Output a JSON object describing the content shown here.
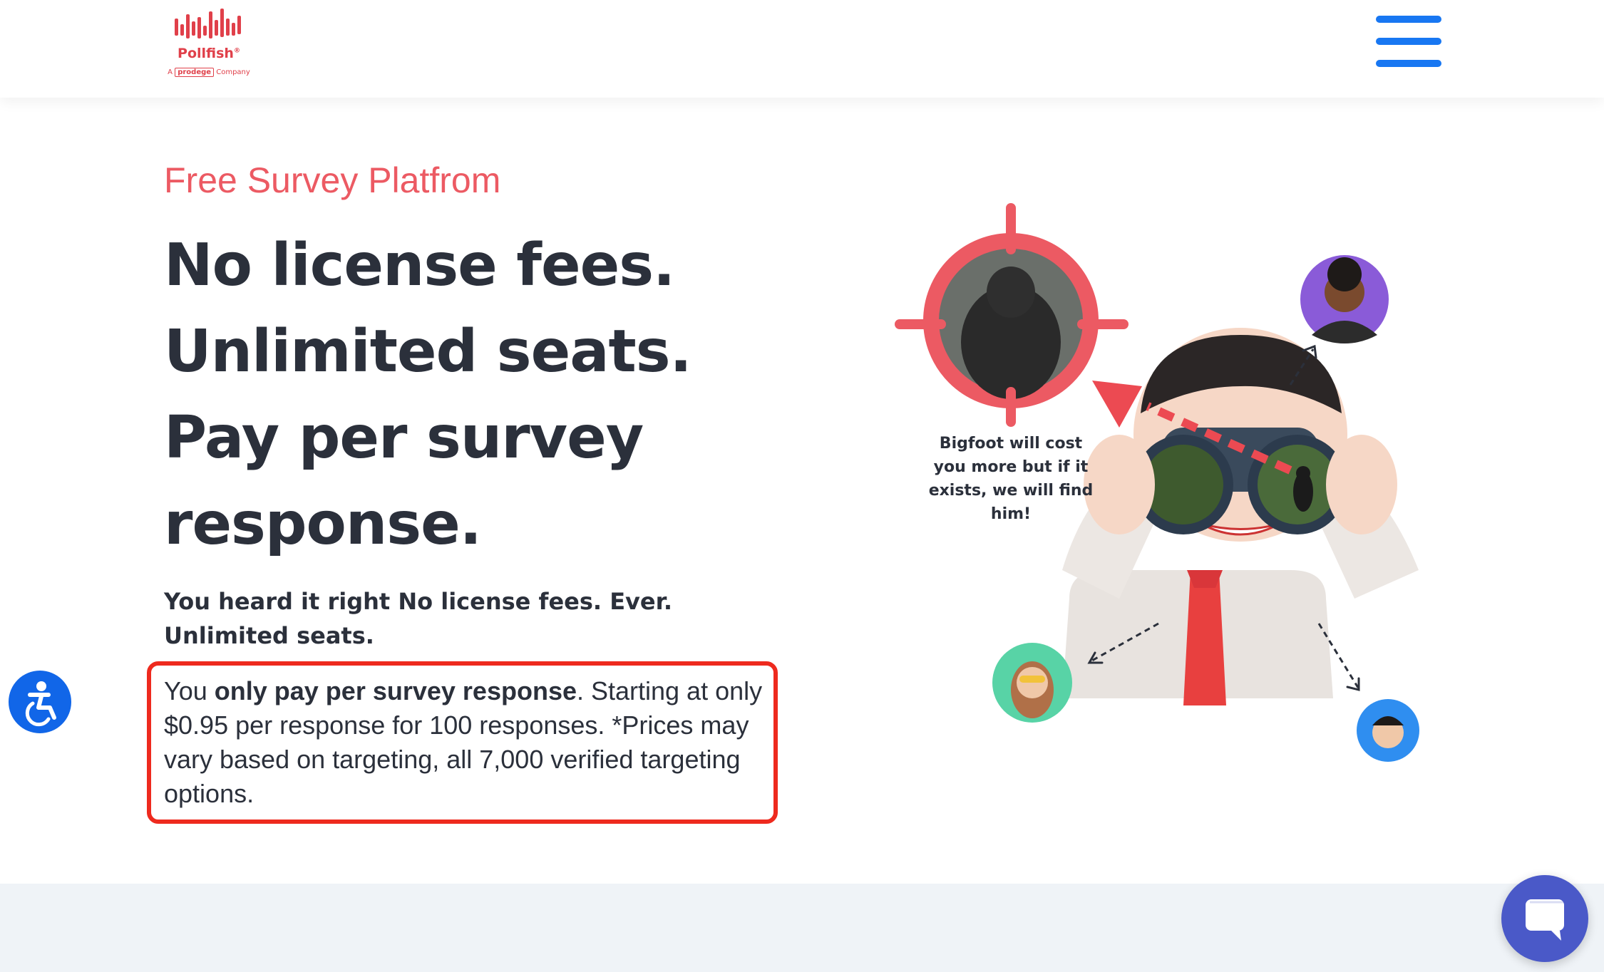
{
  "header": {
    "logo": {
      "name": "Pollfish",
      "registered_mark": "®",
      "tagline_prefix": "A",
      "tagline_brand": "prodege",
      "tagline_suffix": "Company",
      "color": "#e0404a"
    },
    "menu_icon": "hamburger-menu-icon",
    "menu_color": "#1877f2"
  },
  "hero": {
    "eyebrow": "Free Survey Platfrom",
    "title": "No license fees. Unlimited seats. Pay per survey response.",
    "lede": "You heard it right No license fees. Ever. Unlimited seats.",
    "pricing": {
      "prefix": "You ",
      "emphasis": "only pay per survey response",
      "rest": ". Starting at only $0.95 per response for 100 responses. *Prices may vary based on targeting, all 7,000 verified targeting options."
    }
  },
  "illustration": {
    "caption": "Bigfoot will cost you more but if it exists, we will find him!",
    "icons": [
      "crosshair-target-icon",
      "bigfoot-photo",
      "man-with-binoculars",
      "avatar-woman-purple",
      "avatar-woman-green",
      "avatar-man-blue"
    ]
  },
  "floating": {
    "accessibility_icon": "accessibility-icon",
    "chat_icon": "chat-bubble-icon"
  },
  "colors": {
    "accent_red": "#ec5a63",
    "highlight_border": "#ee2a1e",
    "heading": "#2b303b",
    "accessibility_blue": "#1166e8",
    "chat_purple": "#4a59c8",
    "band": "#eff3f7"
  }
}
